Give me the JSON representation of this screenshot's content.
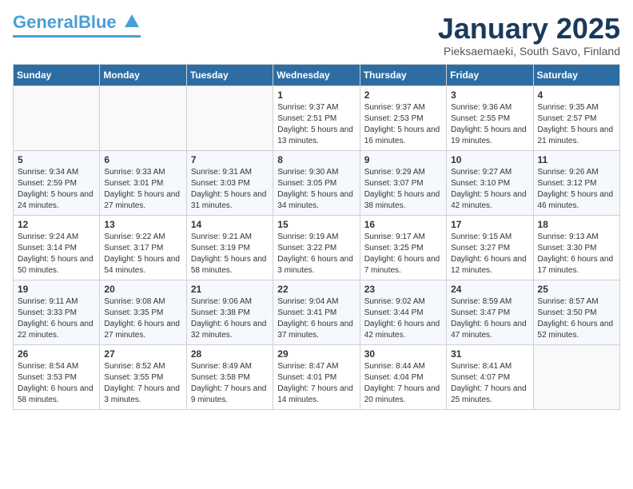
{
  "header": {
    "logo_general": "General",
    "logo_blue": "Blue",
    "month_title": "January 2025",
    "subtitle": "Pieksaemaeki, South Savo, Finland"
  },
  "days_of_week": [
    "Sunday",
    "Monday",
    "Tuesday",
    "Wednesday",
    "Thursday",
    "Friday",
    "Saturday"
  ],
  "weeks": [
    [
      {
        "day": "",
        "sunrise": "",
        "sunset": "",
        "daylight": ""
      },
      {
        "day": "",
        "sunrise": "",
        "sunset": "",
        "daylight": ""
      },
      {
        "day": "",
        "sunrise": "",
        "sunset": "",
        "daylight": ""
      },
      {
        "day": "1",
        "sunrise": "Sunrise: 9:37 AM",
        "sunset": "Sunset: 2:51 PM",
        "daylight": "Daylight: 5 hours and 13 minutes."
      },
      {
        "day": "2",
        "sunrise": "Sunrise: 9:37 AM",
        "sunset": "Sunset: 2:53 PM",
        "daylight": "Daylight: 5 hours and 16 minutes."
      },
      {
        "day": "3",
        "sunrise": "Sunrise: 9:36 AM",
        "sunset": "Sunset: 2:55 PM",
        "daylight": "Daylight: 5 hours and 19 minutes."
      },
      {
        "day": "4",
        "sunrise": "Sunrise: 9:35 AM",
        "sunset": "Sunset: 2:57 PM",
        "daylight": "Daylight: 5 hours and 21 minutes."
      }
    ],
    [
      {
        "day": "5",
        "sunrise": "Sunrise: 9:34 AM",
        "sunset": "Sunset: 2:59 PM",
        "daylight": "Daylight: 5 hours and 24 minutes."
      },
      {
        "day": "6",
        "sunrise": "Sunrise: 9:33 AM",
        "sunset": "Sunset: 3:01 PM",
        "daylight": "Daylight: 5 hours and 27 minutes."
      },
      {
        "day": "7",
        "sunrise": "Sunrise: 9:31 AM",
        "sunset": "Sunset: 3:03 PM",
        "daylight": "Daylight: 5 hours and 31 minutes."
      },
      {
        "day": "8",
        "sunrise": "Sunrise: 9:30 AM",
        "sunset": "Sunset: 3:05 PM",
        "daylight": "Daylight: 5 hours and 34 minutes."
      },
      {
        "day": "9",
        "sunrise": "Sunrise: 9:29 AM",
        "sunset": "Sunset: 3:07 PM",
        "daylight": "Daylight: 5 hours and 38 minutes."
      },
      {
        "day": "10",
        "sunrise": "Sunrise: 9:27 AM",
        "sunset": "Sunset: 3:10 PM",
        "daylight": "Daylight: 5 hours and 42 minutes."
      },
      {
        "day": "11",
        "sunrise": "Sunrise: 9:26 AM",
        "sunset": "Sunset: 3:12 PM",
        "daylight": "Daylight: 5 hours and 46 minutes."
      }
    ],
    [
      {
        "day": "12",
        "sunrise": "Sunrise: 9:24 AM",
        "sunset": "Sunset: 3:14 PM",
        "daylight": "Daylight: 5 hours and 50 minutes."
      },
      {
        "day": "13",
        "sunrise": "Sunrise: 9:22 AM",
        "sunset": "Sunset: 3:17 PM",
        "daylight": "Daylight: 5 hours and 54 minutes."
      },
      {
        "day": "14",
        "sunrise": "Sunrise: 9:21 AM",
        "sunset": "Sunset: 3:19 PM",
        "daylight": "Daylight: 5 hours and 58 minutes."
      },
      {
        "day": "15",
        "sunrise": "Sunrise: 9:19 AM",
        "sunset": "Sunset: 3:22 PM",
        "daylight": "Daylight: 6 hours and 3 minutes."
      },
      {
        "day": "16",
        "sunrise": "Sunrise: 9:17 AM",
        "sunset": "Sunset: 3:25 PM",
        "daylight": "Daylight: 6 hours and 7 minutes."
      },
      {
        "day": "17",
        "sunrise": "Sunrise: 9:15 AM",
        "sunset": "Sunset: 3:27 PM",
        "daylight": "Daylight: 6 hours and 12 minutes."
      },
      {
        "day": "18",
        "sunrise": "Sunrise: 9:13 AM",
        "sunset": "Sunset: 3:30 PM",
        "daylight": "Daylight: 6 hours and 17 minutes."
      }
    ],
    [
      {
        "day": "19",
        "sunrise": "Sunrise: 9:11 AM",
        "sunset": "Sunset: 3:33 PM",
        "daylight": "Daylight: 6 hours and 22 minutes."
      },
      {
        "day": "20",
        "sunrise": "Sunrise: 9:08 AM",
        "sunset": "Sunset: 3:35 PM",
        "daylight": "Daylight: 6 hours and 27 minutes."
      },
      {
        "day": "21",
        "sunrise": "Sunrise: 9:06 AM",
        "sunset": "Sunset: 3:38 PM",
        "daylight": "Daylight: 6 hours and 32 minutes."
      },
      {
        "day": "22",
        "sunrise": "Sunrise: 9:04 AM",
        "sunset": "Sunset: 3:41 PM",
        "daylight": "Daylight: 6 hours and 37 minutes."
      },
      {
        "day": "23",
        "sunrise": "Sunrise: 9:02 AM",
        "sunset": "Sunset: 3:44 PM",
        "daylight": "Daylight: 6 hours and 42 minutes."
      },
      {
        "day": "24",
        "sunrise": "Sunrise: 8:59 AM",
        "sunset": "Sunset: 3:47 PM",
        "daylight": "Daylight: 6 hours and 47 minutes."
      },
      {
        "day": "25",
        "sunrise": "Sunrise: 8:57 AM",
        "sunset": "Sunset: 3:50 PM",
        "daylight": "Daylight: 6 hours and 52 minutes."
      }
    ],
    [
      {
        "day": "26",
        "sunrise": "Sunrise: 8:54 AM",
        "sunset": "Sunset: 3:53 PM",
        "daylight": "Daylight: 6 hours and 58 minutes."
      },
      {
        "day": "27",
        "sunrise": "Sunrise: 8:52 AM",
        "sunset": "Sunset: 3:55 PM",
        "daylight": "Daylight: 7 hours and 3 minutes."
      },
      {
        "day": "28",
        "sunrise": "Sunrise: 8:49 AM",
        "sunset": "Sunset: 3:58 PM",
        "daylight": "Daylight: 7 hours and 9 minutes."
      },
      {
        "day": "29",
        "sunrise": "Sunrise: 8:47 AM",
        "sunset": "Sunset: 4:01 PM",
        "daylight": "Daylight: 7 hours and 14 minutes."
      },
      {
        "day": "30",
        "sunrise": "Sunrise: 8:44 AM",
        "sunset": "Sunset: 4:04 PM",
        "daylight": "Daylight: 7 hours and 20 minutes."
      },
      {
        "day": "31",
        "sunrise": "Sunrise: 8:41 AM",
        "sunset": "Sunset: 4:07 PM",
        "daylight": "Daylight: 7 hours and 25 minutes."
      },
      {
        "day": "",
        "sunrise": "",
        "sunset": "",
        "daylight": ""
      }
    ]
  ]
}
